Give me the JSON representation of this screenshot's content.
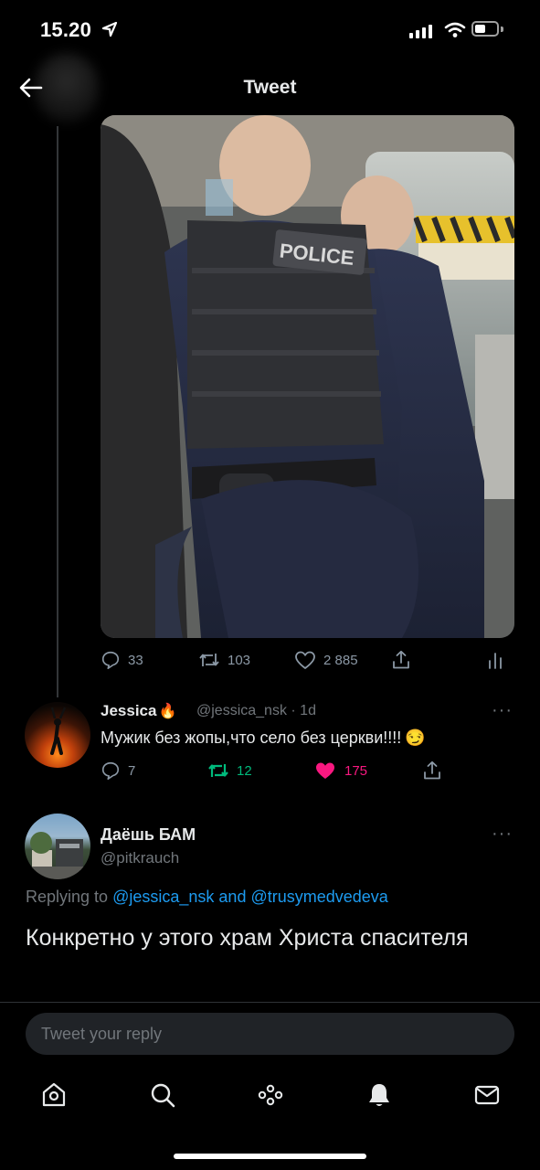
{
  "status_bar": {
    "time": "15.20"
  },
  "header": {
    "title": "Tweet"
  },
  "main_tweet_actions": {
    "replies": "33",
    "retweets": "103",
    "likes": "2 885"
  },
  "photo": {
    "vest_text": "POLICE"
  },
  "reply_1": {
    "name": "Jessica",
    "name_emoji": "🔥",
    "handle": "@jessica_nsk",
    "time": "· 1d",
    "text": "Мужик без жопы,что село без церкви!!!!",
    "text_emoji": "😏",
    "replies": "7",
    "retweets": "12",
    "likes": "175",
    "more": "···"
  },
  "reply_2": {
    "name": "Даёшь БАМ",
    "handle": "@pitkrauch",
    "replying_prefix": "Replying to",
    "replying_user_1": "@jessica_nsk",
    "replying_and": "and",
    "replying_user_2": "@trusymedvedeva",
    "text": "Конкретно у этого храм Христа спасителя",
    "more": "···"
  },
  "reply_input": {
    "placeholder": "Tweet your reply"
  },
  "colors": {
    "accent": "#1d9bf0",
    "retweet_active": "#00ba7c",
    "like_active": "#f91880",
    "muted": "#71767b"
  },
  "tab_bar": [
    "home-icon",
    "search-icon",
    "spaces-icon",
    "notifications-icon",
    "messages-icon"
  ]
}
